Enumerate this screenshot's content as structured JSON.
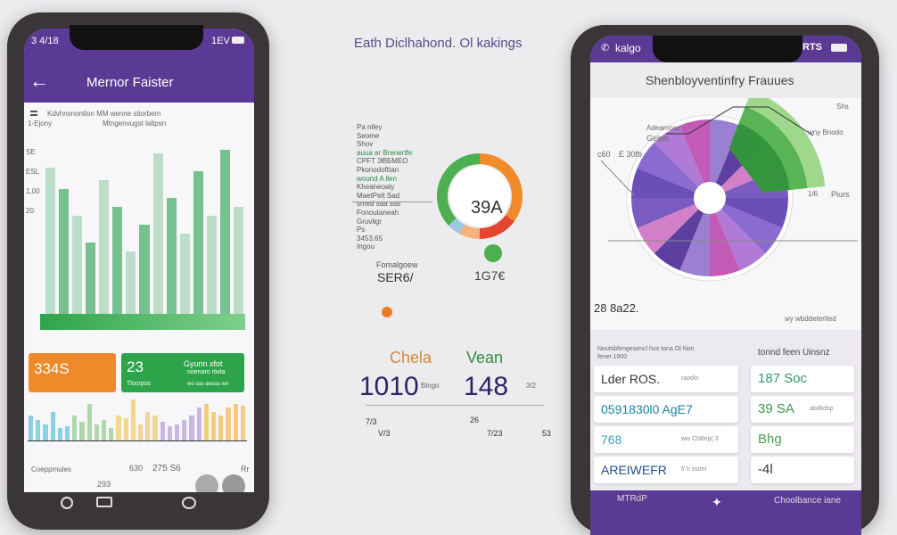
{
  "center": {
    "title": "Eath Diclhahond. Ol kakings",
    "legend": [
      "Pa niley",
      "Seome",
      "Shov",
      "auua ar Brenertfe",
      "CPFT ЭВБМЕО",
      "Pkonodofttan",
      "wound A llen",
      "Kheaneoaly",
      "MaetPelt Sad",
      "smed saa sas",
      "Fonoutaneah",
      "Gruvligr",
      "Ps",
      "3453.65",
      "Ingou"
    ],
    "donut_value": "39A",
    "stat_left_label": "Fomalgoew",
    "stat_left_value": "SER6/",
    "stat_right_value": "1G7€",
    "metric_left_label": "Chela",
    "metric_left_value": "1010",
    "metric_left_small": "Bingo",
    "metric_right_label": "Vean",
    "metric_right_value": "148",
    "metric_right_small": "3/2",
    "foot": [
      "7/3",
      "V/3",
      "26",
      "7/23",
      "53"
    ],
    "donut_colors": [
      "#f08a2a",
      "#e4452f",
      "#f4b27a",
      "#9fc8e0",
      "#4caf50"
    ]
  },
  "left_phone": {
    "status_left": "3 4/18",
    "status_right": "1EV",
    "header_title": "Mernor Faister",
    "chart_caption1": "Kdvhnvnontlon MM wenne stiorbem",
    "chart_caption2": "Mtngenvugst laltpsn",
    "chart_sublabel": "1-Ejony",
    "y_labels": [
      "SE",
      "ESL",
      "1,00",
      "20"
    ],
    "bars": [
      0.82,
      0.7,
      0.55,
      0.4,
      0.75,
      0.6,
      0.35,
      0.5,
      0.9,
      0.65,
      0.45,
      0.8,
      0.55,
      0.92,
      0.6
    ],
    "card_orange": {
      "value": "334S",
      "color": "#ee8a2a"
    },
    "card_green": {
      "value": "23",
      "line1": "Gyunn xfot",
      "line2": "noenaro rtwla",
      "foot": "Tlocrpos",
      "foot2": "wo sas aesoa wo",
      "color": "#2ea44a"
    },
    "strip": [
      0.6,
      0.5,
      0.4,
      0.7,
      0.3,
      0.35,
      0.6,
      0.45,
      0.9,
      0.4,
      0.5,
      0.3,
      0.6,
      0.55,
      1.0,
      0.4,
      0.7,
      0.6,
      0.45,
      0.35,
      0.4,
      0.5,
      0.6,
      0.8,
      0.9,
      0.7,
      0.6,
      0.8,
      0.9,
      0.85
    ],
    "strip_colors": [
      "#5bc0de",
      "#8fc98b",
      "#f5c56b",
      "#b19cd9",
      "#f2b84b"
    ],
    "bottom_label": "Coeppmules",
    "bottom_v1": "630",
    "bottom_v2": "275 S6",
    "bottom_v3": "293",
    "bottom_v4": "Rr"
  },
  "right_phone": {
    "status_left": "kalgo",
    "status_right": "RTS",
    "title": "Shenbloyventinfry Frauues",
    "labels": {
      "tl1": "Adeamoas",
      "tl2": "Gelpls",
      "tr": "Shs",
      "tr2": "wny Bnodo",
      "l": "c60",
      "l2": "E 30fb",
      "r": "Piurs",
      "r2": "1/6",
      "bl": "28 8a22.",
      "br": "wy wbddeterited"
    },
    "pie_colors": [
      "#6b4fb8",
      "#8c6bd0",
      "#b07ad6",
      "#c25bb6",
      "#9b7fd0",
      "#5c3f9e",
      "#d280c8",
      "#7a5cc0"
    ],
    "green_wedge": [
      "#8fd27a",
      "#4cae4c",
      "#2f8f3a"
    ],
    "section_left": "Noutsbfengesencl hos  tona Ol Non fenet 1900",
    "section_right": "tonnd feen Uinsnz",
    "left_rows": [
      {
        "v": "Lder ROS.",
        "s": "raodin",
        "c": "#333"
      },
      {
        "v": "0591830l0 AgE7",
        "s": "",
        "c": "#1e7fa0"
      },
      {
        "v": "768",
        "s": "ww ChBep( 3",
        "c": "#3aa0b8"
      },
      {
        "v": "AREIWEFR",
        "s": "f/ h ssonl",
        "c": "#1f4e8a"
      }
    ],
    "right_rows": [
      {
        "v": "187 Soc",
        "c": "#2a9a6a"
      },
      {
        "v": "39 SA",
        "s": "abdkdsp",
        "c": "#3a9a4a"
      },
      {
        "v": "Bhg",
        "c": "#4aa050"
      },
      {
        "v": "-4l",
        "c": "#333"
      }
    ],
    "bottom_left": "MTRdP",
    "bottom_right": "Choolbance iane"
  }
}
